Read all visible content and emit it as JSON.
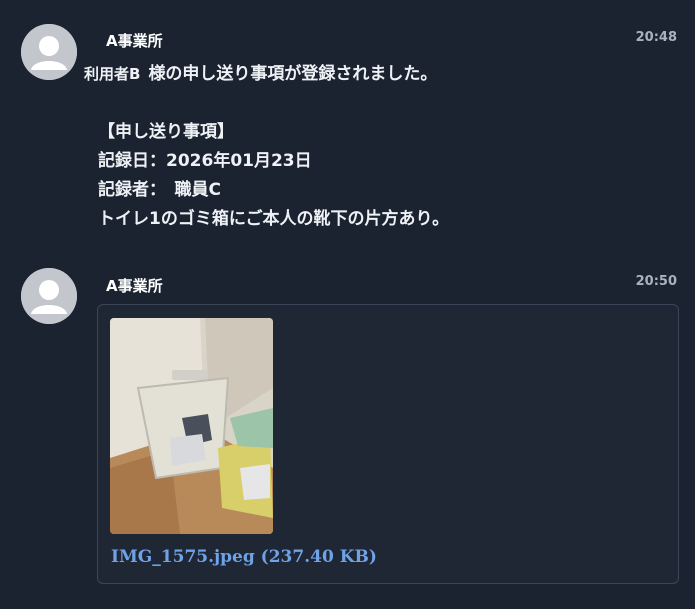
{
  "messages": [
    {
      "sender": "A事業所",
      "time": "20:48",
      "user_label": "利用者B",
      "lines": [
        "様の申し送り事項が登録されました。",
        "【申し送り事項】",
        "記録日：2026年01月23日",
        "記録者：　職員C",
        "トイレ1のゴミ箱にご本人の靴下の片方あり。"
      ]
    },
    {
      "sender": "A事業所",
      "time": "20:50",
      "attachment": {
        "file_link": "IMG_1575.jpeg (237.40 KB)"
      }
    }
  ],
  "icons": {
    "avatar": "user-silhouette-icon"
  },
  "colors": {
    "background": "#1b2330",
    "card_background": "#1f2735",
    "link": "#6fa2e6"
  }
}
